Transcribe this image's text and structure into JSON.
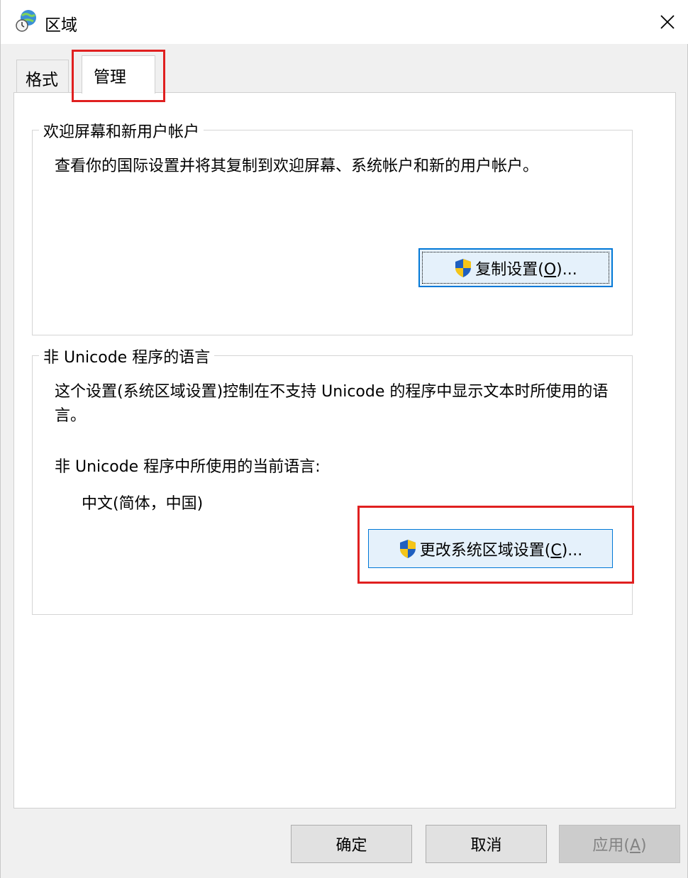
{
  "window": {
    "title": "区域",
    "close_symbol": "✕"
  },
  "tabs": [
    {
      "label": "格式",
      "active": false
    },
    {
      "label": "管理",
      "active": true
    }
  ],
  "welcome_group": {
    "legend": "欢迎屏幕和新用户帐户",
    "description": "查看你的国际设置并将其复制到欢迎屏幕、系统帐户和新的用户帐户。",
    "copy_button": {
      "label_main": "复制设置(",
      "mnemonic": "O",
      "label_end": ")...",
      "icon": "uac-shield-icon"
    }
  },
  "unicode_group": {
    "legend": "非 Unicode 程序的语言",
    "description": "这个设置(系统区域设置)控制在不支持 Unicode 的程序中显示文本时所使用的语言。",
    "current_label": "非 Unicode 程序中所使用的当前语言:",
    "current_value": "中文(简体，中国)",
    "change_button": {
      "label_main": "更改系统区域设置(",
      "mnemonic": "C",
      "label_end": ")...",
      "icon": "uac-shield-icon"
    }
  },
  "footer": {
    "ok_label": "确定",
    "cancel_label": "取消",
    "apply_main": "应用(",
    "apply_mnemonic": "A",
    "apply_end": ")"
  },
  "colors": {
    "highlight": "#e02020",
    "focus": "#0078d7"
  }
}
